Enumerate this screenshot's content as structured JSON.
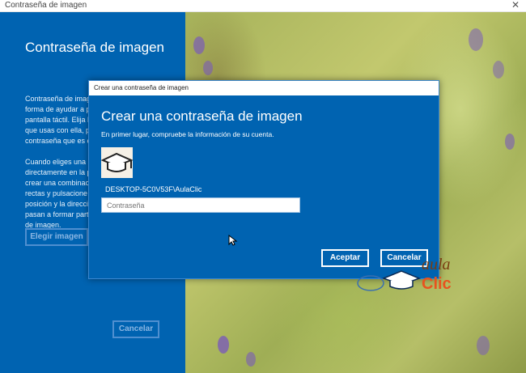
{
  "window": {
    "title": "Contraseña de imagen",
    "close_glyph": "✕"
  },
  "left_pane": {
    "heading": "Contraseña de imagen",
    "paragraph1": [
      "Contraseña de imag",
      "forma de ayudar a p",
      "pantalla táctil. Elija la",
      "que usas con ella, p",
      "contraseña que es e"
    ],
    "paragraph2": [
      "Cuando eliges una i",
      "directamente en la p",
      "crear una combinac",
      "rectas y pulsacione",
      "posición y la direcci",
      "pasan a formar part",
      "de imagen."
    ],
    "choose_image_button": "Elegir imagen",
    "cancel_button": "Cancelar"
  },
  "dialog": {
    "title": "Crear una contraseña de imagen",
    "heading": "Crear una contraseña de imagen",
    "subtitle": "En primer lugar, compruebe la información de su cuenta.",
    "account": "DESKTOP-5C0V53F\\AulaClic",
    "password_placeholder": "Contraseña",
    "accept_button": "Aceptar",
    "cancel_button": "Cancelar"
  },
  "watermark": {
    "line1": "aula",
    "line2": "Clic"
  },
  "colors": {
    "accent": "#0063b1",
    "watermark_brown": "#7a3c10",
    "watermark_orange": "#e8531e"
  },
  "icons": {
    "avatar": "graduation-cap-icon",
    "cursor": "mouse-pointer-icon",
    "close": "close-icon"
  }
}
